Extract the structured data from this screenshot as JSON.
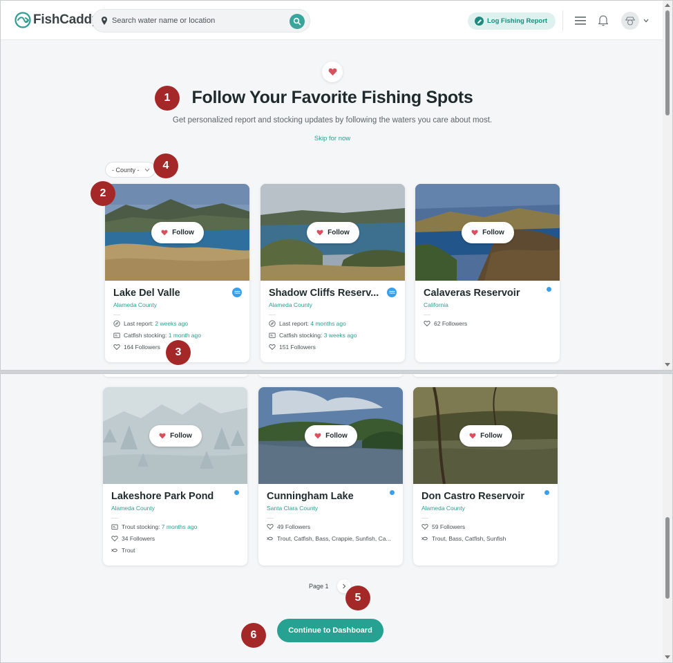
{
  "header": {
    "logo_text": "FishCaddy",
    "search_placeholder": "Search water name or location",
    "log_report_label": "Log Fishing Report"
  },
  "hero": {
    "title": "Follow Your Favorite Fishing Spots",
    "subtitle": "Get personalized report and stocking updates by following the waters you care about most.",
    "skip_label": "Skip for now",
    "county_filter": "- County -"
  },
  "markers": [
    "1",
    "2",
    "3",
    "4",
    "5",
    "6"
  ],
  "follow_label": "Follow",
  "cards": [
    {
      "name": "Lake Del Valle",
      "county": "Alameda County",
      "badge": "stream-icon",
      "last_report_label": "Last report: ",
      "last_report_value": "2 weeks ago",
      "stocking_label": "Catfish stocking: ",
      "stocking_value": "1 month ago",
      "followers": "164 Followers"
    },
    {
      "name": "Shadow Cliffs Reserv...",
      "county": "Alameda County",
      "badge": "stream-icon",
      "last_report_label": "Last report: ",
      "last_report_value": "4 months ago",
      "stocking_label": "Catfish stocking: ",
      "stocking_value": "3 weeks ago",
      "followers": "151 Followers"
    },
    {
      "name": "Calaveras Reservoir",
      "county": "California",
      "badge": "dot",
      "followers": "62 Followers"
    },
    {
      "name": "Lakeshore Park Pond",
      "county": "Alameda County",
      "badge": "dot",
      "stocking_label": "Trout stocking: ",
      "stocking_value": "7 months ago",
      "followers": "34 Followers",
      "species": "Trout"
    },
    {
      "name": "Cunningham Lake",
      "county": "Santa Clara County",
      "badge": "dot",
      "followers": "49 Followers",
      "species": "Trout, Catfish, Bass, Crappie, Sunfish, Ca..."
    },
    {
      "name": "Don Castro Reservoir",
      "county": "Alameda County",
      "badge": "dot",
      "followers": "59 Followers",
      "species": "Trout, Bass, Catfish, Sunfish"
    }
  ],
  "pagination": {
    "page_label": "Page 1"
  },
  "continue_label": "Continue to Dashboard",
  "colors": {
    "accent": "#27a192",
    "marker": "#a42828",
    "heart": "#d9505f",
    "link": "#2d9d91"
  }
}
